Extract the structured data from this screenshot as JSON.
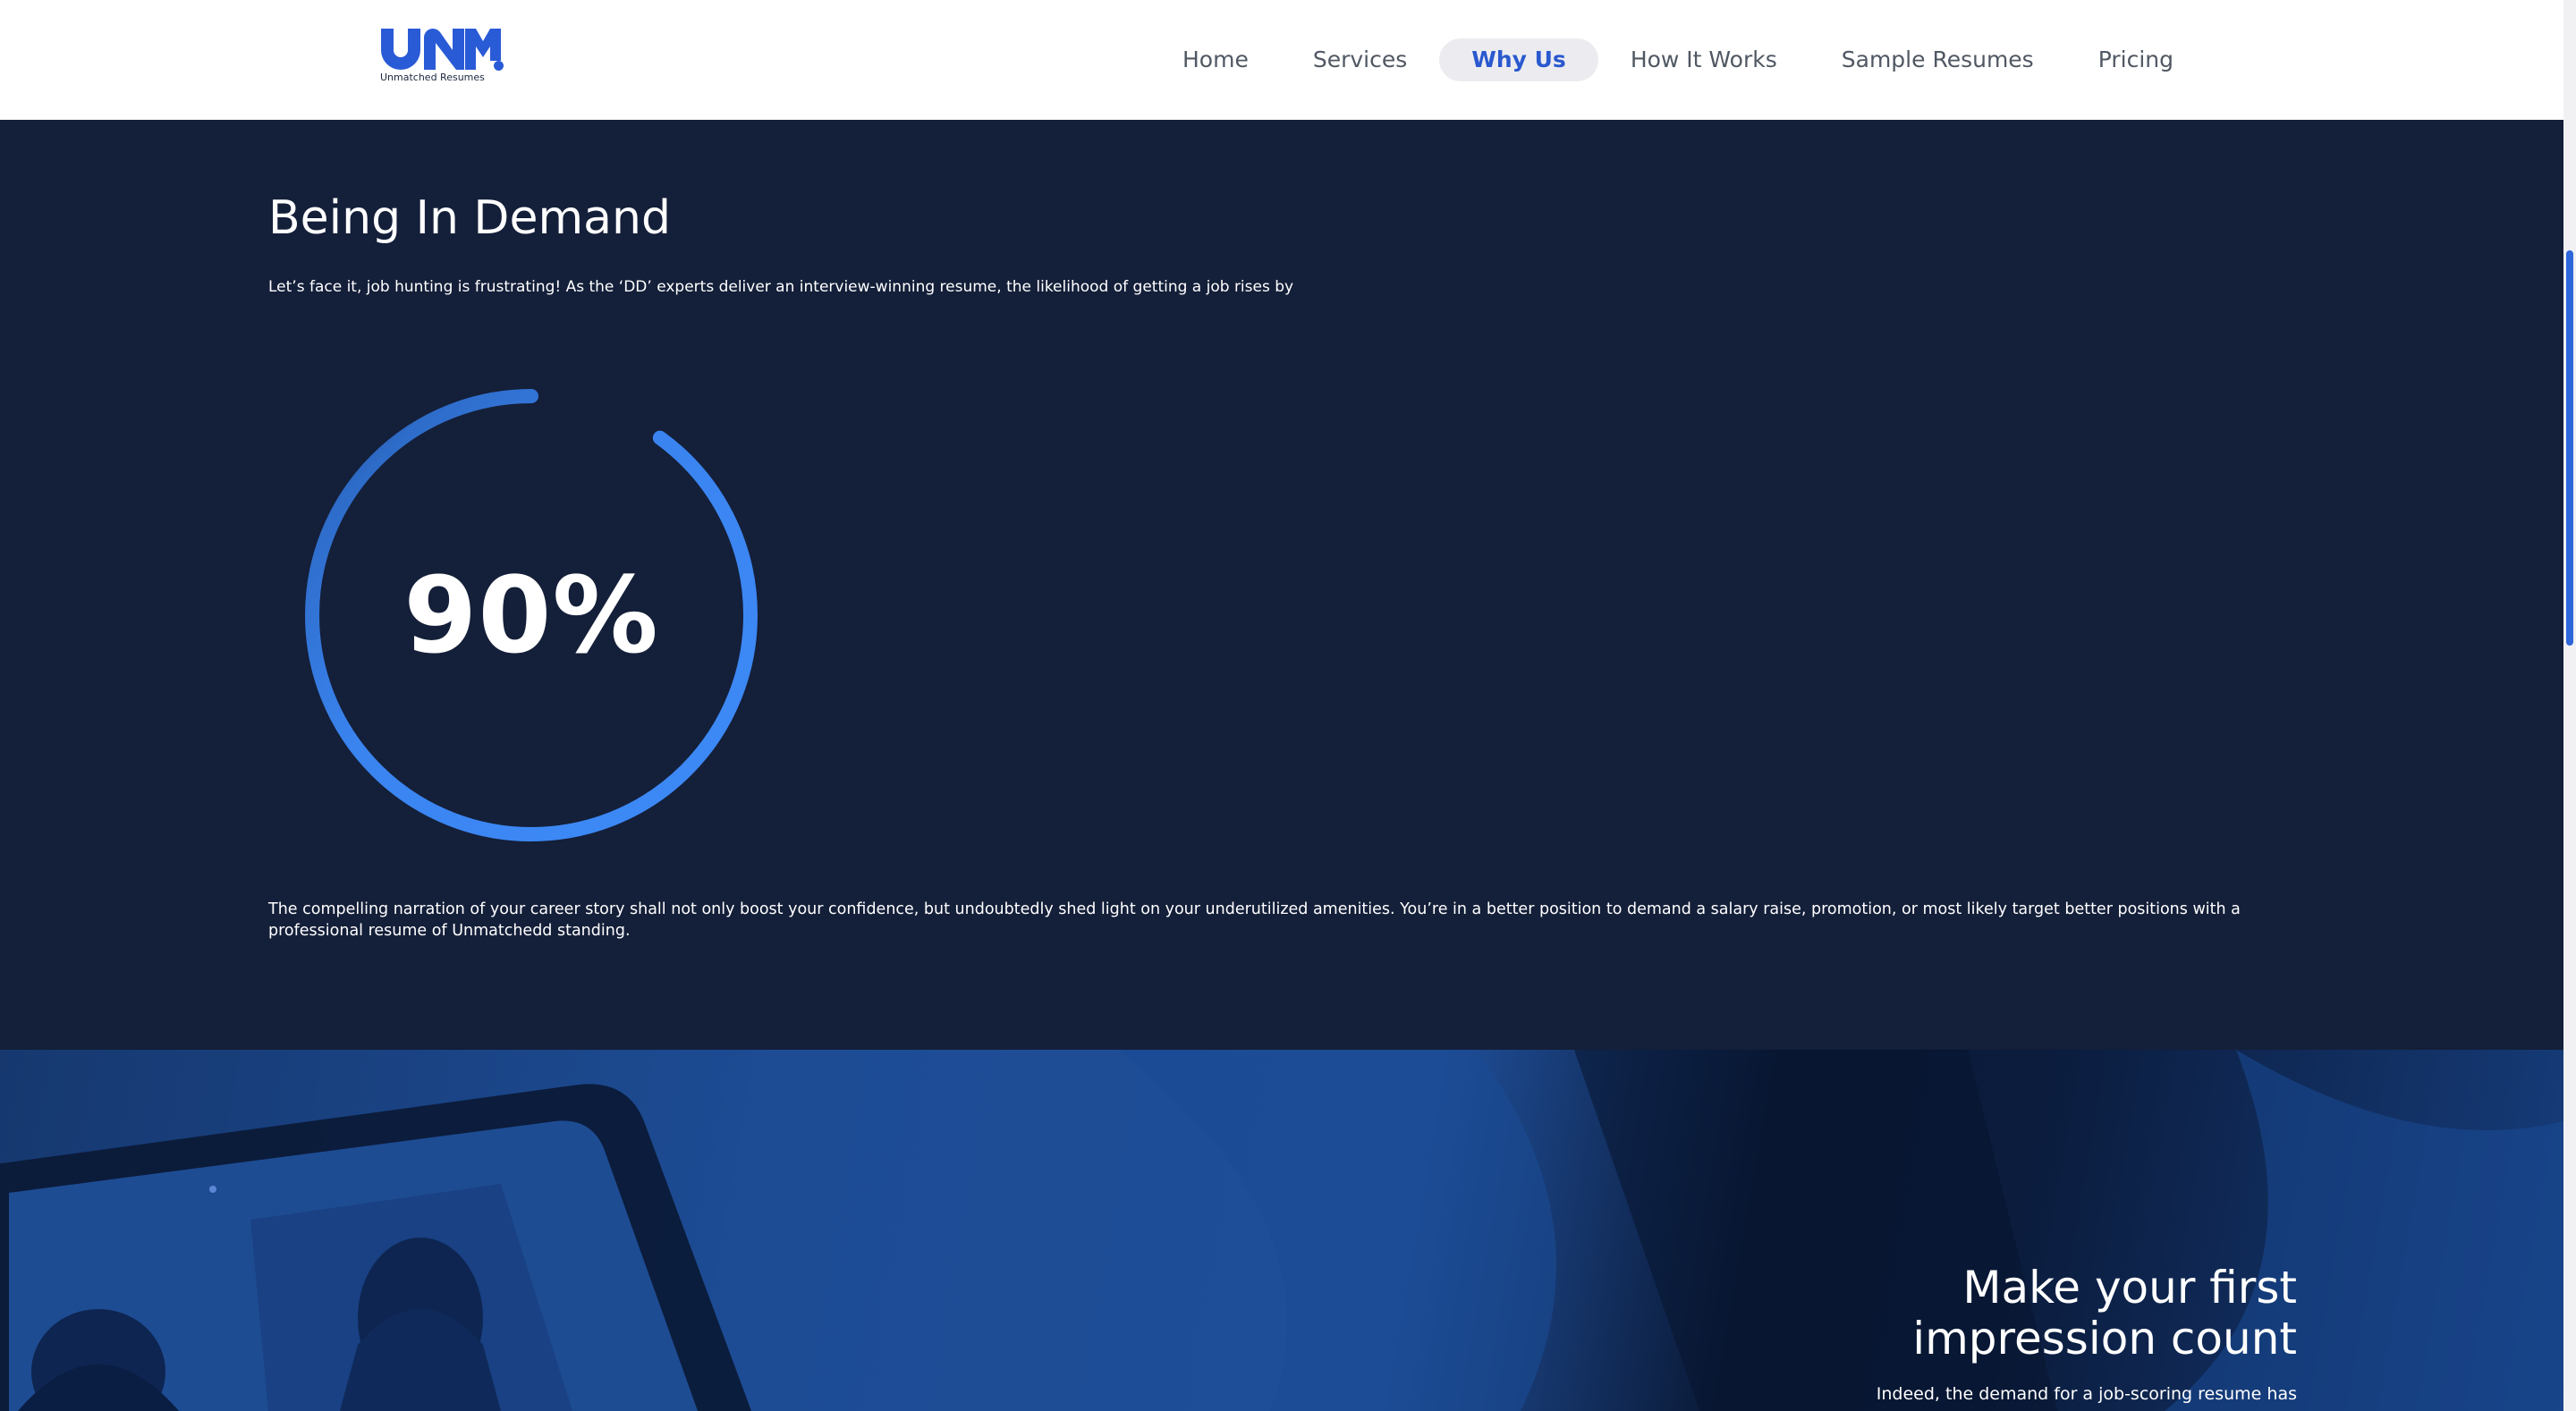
{
  "header": {
    "logo_text": "UNM",
    "logo_tagline": "Unmatched Resumes",
    "nav": [
      {
        "label": "Home",
        "active": false
      },
      {
        "label": "Services",
        "active": false
      },
      {
        "label": "Why Us",
        "active": true
      },
      {
        "label": "How It Works",
        "active": false
      },
      {
        "label": "Sample Resumes",
        "active": false
      },
      {
        "label": "Pricing",
        "active": false
      }
    ]
  },
  "demand": {
    "title": "Being In Demand",
    "lead": "Let’s face it, job hunting is frustrating! As the ‘DD’ experts deliver an interview-winning resume, the likelihood of getting a job rises by",
    "stat_value": "90%",
    "stat_percent": 90,
    "body": "The compelling narration of your career story shall not only boost your confidence, but undoubtedly shed light on your underutilized amenities. You’re in a better position to demand a salary raise, promotion, or most likely target better positions with a professional resume of Unmatchedd standing."
  },
  "impression": {
    "title": "Make your first impression count",
    "body": "Indeed, the demand for a job-scoring resume has"
  },
  "colors": {
    "brand_blue": "#2a5bd7",
    "dark_navy": "#141f39",
    "gauge_blue": "#3d8af7",
    "nav_active_bg": "#ececf0"
  }
}
